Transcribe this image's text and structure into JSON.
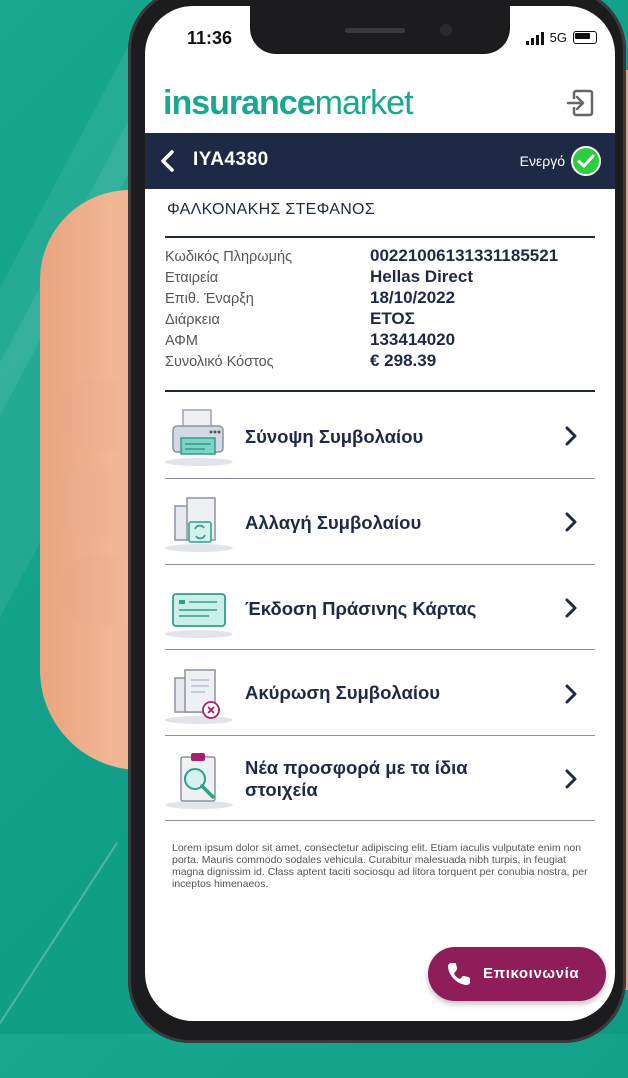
{
  "status_bar": {
    "time": "11:36",
    "network": "5G"
  },
  "app": {
    "logo_bold": "insurance",
    "logo_light": "market"
  },
  "header": {
    "plate": "ΙΥΑ4380",
    "status": "Ενεργό"
  },
  "policy": {
    "owner": "ΦΑΛΚΟΝΑΚΗΣ ΣΤΕΦΑΝΟΣ",
    "details": [
      {
        "label": "Κωδικός Πληρωμής",
        "value": "00221006131331185521"
      },
      {
        "label": "Εταιρεία",
        "value": "Hellas Direct"
      },
      {
        "label": "Επιθ. Έναρξη",
        "value": "18/10/2022"
      },
      {
        "label": "Διάρκεια",
        "value": "ΕΤΟΣ"
      },
      {
        "label": "ΑΦΜ",
        "value": "133414020"
      },
      {
        "label": "Συνολικό Κόστος",
        "value": "€ 298.39"
      }
    ]
  },
  "menu": [
    {
      "label": "Σύνοψη Συμβολαίου",
      "icon": "printer-icon"
    },
    {
      "label": "Αλλαγή Συμβολαίου",
      "icon": "document-refresh-icon"
    },
    {
      "label": "Έκδοση Πράσινης Κάρτας",
      "icon": "green-card-icon"
    },
    {
      "label": "Ακύρωση Συμβολαίου",
      "icon": "document-cancel-icon"
    },
    {
      "label": "Νέα προσφορά με τα ίδια στοιχεία",
      "icon": "clipboard-search-icon"
    }
  ],
  "disclaimer": "Lorem ipsum dolor sit amet, consectetur adipiscing elit. Etiam iaculis vulputate enim non porta. Mauris commodo sodales vehicula. Curabitur malesuada nibh turpis, in feugiat magna dignissim id. Class aptent taciti sociosqu ad litora torquent per conubia nostra, per inceptos himenaeos.",
  "contact_button": "Επικοινωνία",
  "colors": {
    "brand_teal": "#17a88f",
    "navy": "#1e2a45",
    "active_green": "#2ecc40",
    "contact_plum": "#8f1d5a"
  }
}
